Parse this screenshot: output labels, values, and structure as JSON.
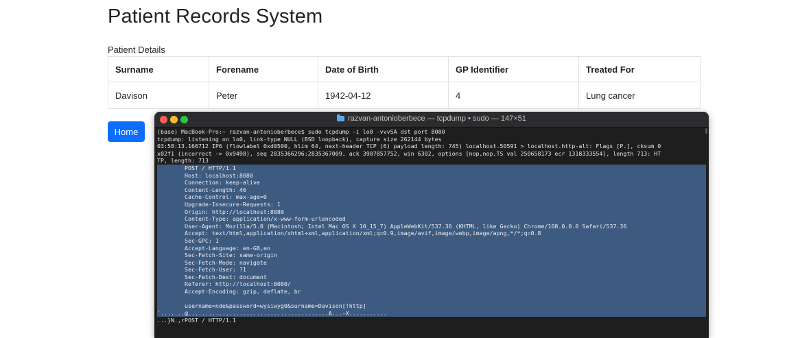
{
  "page": {
    "title": "Patient Records System",
    "caption": "Patient Details",
    "home_button": "Home"
  },
  "table": {
    "headers": [
      "Surname",
      "Forename",
      "Date of Birth",
      "GP Identifier",
      "Treated For"
    ],
    "rows": [
      [
        "Davison",
        "Peter",
        "1942-04-12",
        "4",
        "Lung cancer"
      ]
    ]
  },
  "terminal": {
    "title": "razvan-antonioberbece — tcpdump • sudo — 147×51",
    "lines_before": [
      "(base) MacBook-Pro:~ razvan-antonioberbece$ sudo tcpdump -i lo0 -vvvSA dst port 8080",
      "tcpdump: listening on lo0, link-type NULL (BSD loopback), capture size 262144 bytes",
      "03:58:13.166712 IP6 (flowlabel 0xd0500, hlim 64, next-header TCP (6) payload length: 745) localhost.50591 > localhost.http-alt: Flags [P.], cksum 0",
      "x02f1 (incorrect -> 0x9498), seq 2835366296:2835367009, ack 3907857752, win 6302, options [nop,nop,TS val 250658173 ecr 1318333554], length 713: HT",
      "TP, length: 713"
    ],
    "selected_lines": [
      "        POST / HTTP/1.1",
      "        Host: localhost:8080",
      "        Connection: keep-alive",
      "        Content-Length: 46",
      "        Cache-Control: max-age=0",
      "        Upgrade-Insecure-Requests: 1",
      "        Origin: http://localhost:8080",
      "        Content-Type: application/x-www-form-urlencoded",
      "        User-Agent: Mozilla/5.0 (Macintosh; Intel Mac OS X 10_15_7) AppleWebKit/537.36 (KHTML, like Gecko) Chrome/108.0.0.0 Safari/537.36",
      "        Accept: text/html,application/xhtml+xml,application/xml;q=0.9,image/avif,image/webp,image/apng,*/*;q=0.8",
      "        Sec-GPC: 1",
      "        Accept-Language: en-GB,en",
      "        Sec-Fetch-Site: same-origin",
      "        Sec-Fetch-Mode: navigate",
      "        Sec-Fetch-User: ?1",
      "        Sec-Fetch-Dest: document",
      "        Referer: http://localhost:8080/",
      "        Accept-Encoding: gzip, deflate, br",
      "",
      "        username=nde&password=wysiwyg0&surname=Davison[!http]",
      "`.......@.........................................A...-X..........."
    ],
    "lines_after": [
      "...}N.,rPOST / HTTP/1.1"
    ],
    "colors": {
      "selection": "#3d5a80",
      "close": "#ff5f57",
      "minimize": "#febc2e",
      "zoom": "#28c840"
    }
  },
  "colors": {
    "primary_button": "#0d6efd",
    "table_border": "#dee2e6"
  }
}
